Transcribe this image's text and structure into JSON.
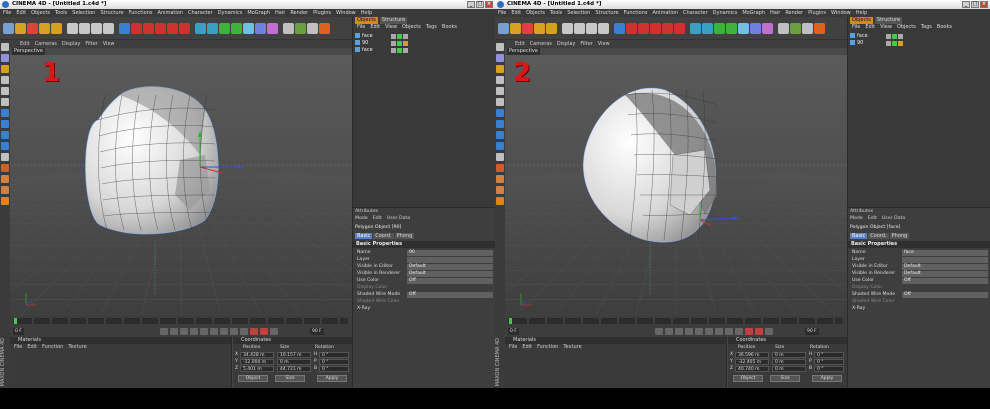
{
  "windows": [
    {
      "id": "w1",
      "title": "CINEMA 4D - [Untitled 1.c4d *]",
      "viewport_number": "1",
      "object_manager": {
        "tabs": [
          "Objects",
          "Structure"
        ],
        "menu": [
          "File",
          "Edit",
          "View",
          "Objects",
          "Tags",
          "Books"
        ],
        "objects": [
          "face",
          "90",
          "face"
        ]
      },
      "attributes": {
        "title": "Attributes",
        "menu": [
          "Mode",
          "Edit",
          "User Data"
        ],
        "object_label": "Polygon Object [90]",
        "tabs": [
          "Basic",
          "Coord.",
          "Phong"
        ],
        "section": "Basic Properties",
        "props": [
          {
            "label": "Name",
            "value": "90"
          },
          {
            "label": "Layer",
            "value": ""
          },
          {
            "label": "Visible in Editor",
            "value": "Default"
          },
          {
            "label": "Visible in Renderer",
            "value": "Default"
          },
          {
            "label": "Use Color",
            "value": "Off"
          },
          {
            "label": "Display Color",
            "value": ""
          },
          {
            "label": "Shaded Wire Mode",
            "value": "Off"
          },
          {
            "label": "Shaded Wire Color",
            "value": ""
          },
          {
            "label": "X-Ray",
            "value": ""
          }
        ]
      },
      "coordinates": {
        "title": "Coordinates",
        "headers": [
          "Position",
          "Size",
          "Rotation"
        ],
        "rows": [
          {
            "axis": "X",
            "pos": "34.428 m",
            "size": "10.157 m",
            "rot": "H",
            "rotval": "0 °"
          },
          {
            "axis": "Y",
            "pos": "-12.004 m",
            "size": "0 m",
            "rot": "P",
            "rotval": "0 °"
          },
          {
            "axis": "Z",
            "pos": "5.401 m",
            "size": "44.721 m",
            "rot": "B",
            "rotval": "0 °"
          }
        ],
        "mode": "Object",
        "size_mode": "Size",
        "apply": "Apply"
      },
      "timeline": {
        "start": "0 F",
        "end": "90 F"
      }
    },
    {
      "id": "w2",
      "title": "CINEMA 4D - [Untitled 1.c4d *]",
      "viewport_number": "2",
      "object_manager": {
        "tabs": [
          "Objects",
          "Structure"
        ],
        "menu": [
          "File",
          "Edit",
          "View",
          "Objects",
          "Tags",
          "Books"
        ],
        "objects": [
          "face",
          "90"
        ]
      },
      "attributes": {
        "title": "Attributes",
        "menu": [
          "Mode",
          "Edit",
          "User Data"
        ],
        "object_label": "Polygon Object [face]",
        "tabs": [
          "Basic",
          "Coord.",
          "Phong"
        ],
        "section": "Basic Properties",
        "props": [
          {
            "label": "Name",
            "value": "face"
          },
          {
            "label": "Layer",
            "value": ""
          },
          {
            "label": "Visible in Editor",
            "value": "Default"
          },
          {
            "label": "Visible in Renderer",
            "value": "Default"
          },
          {
            "label": "Use Color",
            "value": "Off"
          },
          {
            "label": "Display Color",
            "value": ""
          },
          {
            "label": "Shaded Wire Mode",
            "value": "Off"
          },
          {
            "label": "Shaded Wire Color",
            "value": ""
          },
          {
            "label": "X-Ray",
            "value": ""
          }
        ]
      },
      "coordinates": {
        "title": "Coordinates",
        "headers": [
          "Position",
          "Size",
          "Rotation"
        ],
        "rows": [
          {
            "axis": "X",
            "pos": "36.596 m",
            "size": "0 m",
            "rot": "H",
            "rotval": "0 °"
          },
          {
            "axis": "Y",
            "pos": "-32.405 m",
            "size": "0 m",
            "rot": "P",
            "rotval": "0 °"
          },
          {
            "axis": "Z",
            "pos": "40.740 m",
            "size": "0 m",
            "rot": "B",
            "rotval": "0 °"
          }
        ],
        "mode": "Object",
        "size_mode": "Size",
        "apply": "Apply"
      },
      "timeline": {
        "start": "0 F",
        "end": "90 F"
      }
    }
  ],
  "menu": [
    "File",
    "Edit",
    "Objects",
    "Tools",
    "Selection",
    "Structure",
    "Functions",
    "Animation",
    "Character",
    "Dynamics",
    "MoGraph",
    "Hair",
    "Render",
    "Plugins",
    "Window",
    "Help"
  ],
  "viewport_menu": [
    "Edit",
    "Cameras",
    "Display",
    "Filter",
    "View"
  ],
  "viewport_label": "Perspective",
  "materials": {
    "title": "Materials",
    "menu": [
      "File",
      "Edit",
      "Function",
      "Texture"
    ]
  },
  "brand": "MAXON CINEMA 4D",
  "colors": {
    "accent": "#d08a1e",
    "number": "#d81717",
    "axis_x": "#d03030",
    "axis_y": "#30b030",
    "axis_z": "#3050e0"
  }
}
